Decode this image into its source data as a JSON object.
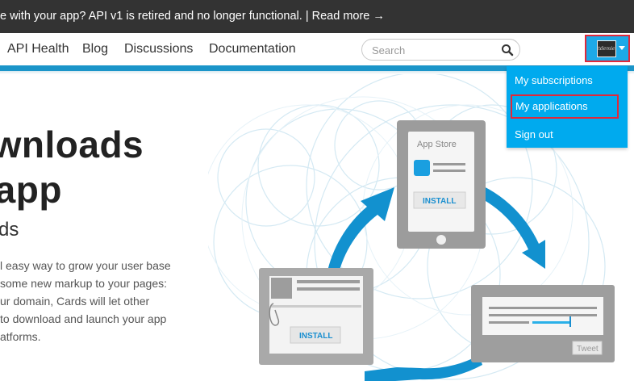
{
  "announcement": {
    "text": "e with your app? API v1 is retired and no longer functional. | Read more →"
  },
  "nav": {
    "links": [
      "API Health",
      "Blog",
      "Discussions",
      "Documentation"
    ]
  },
  "search": {
    "placeholder": "Search",
    "value": ""
  },
  "user_menu": {
    "avatar_text": "tdemie",
    "items": [
      "My subscriptions",
      "My applications",
      "Sign out"
    ],
    "highlighted_item": "My applications"
  },
  "hero": {
    "title_lines": [
      "ownloads",
      "r app"
    ],
    "subtitle": "ds",
    "body_lines": [
      "l easy way to grow your user base",
      "some new markup to your pages:",
      "ur domain, Cards will let other",
      "to download and launch your app",
      "atforms."
    ]
  },
  "illustration": {
    "store_title": "App Store",
    "install_label": "INSTALL",
    "card_install_label": "INSTALL",
    "tweet_label": "Tweet"
  },
  "colors": {
    "accent": "#1b95c9",
    "dropdown": "#00aaee",
    "highlight_border": "#e0283a",
    "announcement_bg": "#333333"
  }
}
